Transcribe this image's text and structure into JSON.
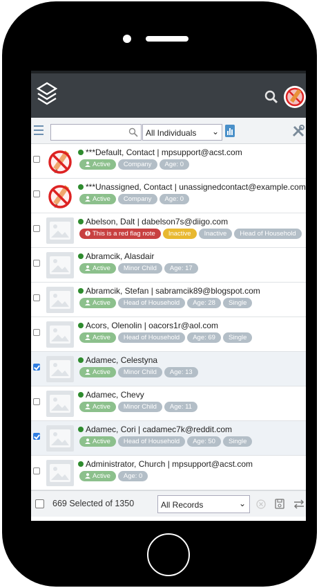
{
  "toolbar": {
    "search_placeholder": "",
    "individuals_select": "All Individuals"
  },
  "records": [
    {
      "name": "***Default, Contact | mpsupport@acst.com",
      "photo": "no-photo",
      "checked": false,
      "badges": [
        {
          "text": "Active",
          "kind": "active"
        },
        {
          "text": "Company",
          "kind": "grey"
        },
        {
          "text": "Age: 0",
          "kind": "grey"
        }
      ]
    },
    {
      "name": "***Unassigned, Contact | unassignedcontact@example.com",
      "photo": "no-photo",
      "checked": false,
      "badges": [
        {
          "text": "Active",
          "kind": "active"
        },
        {
          "text": "Company",
          "kind": "grey"
        },
        {
          "text": "Age: 0",
          "kind": "grey"
        }
      ]
    },
    {
      "name": "Abelson, Dalt | dabelson7s@diigo.com",
      "photo": "placeholder",
      "checked": false,
      "badges": [
        {
          "text": "This is a red flag note",
          "kind": "red"
        },
        {
          "text": "Inactive",
          "kind": "yellow"
        },
        {
          "text": "Inactive",
          "kind": "grey"
        },
        {
          "text": "Head of Household",
          "kind": "grey"
        }
      ]
    },
    {
      "name": "Abramcik, Alasdair",
      "photo": "placeholder",
      "checked": false,
      "badges": [
        {
          "text": "Active",
          "kind": "active"
        },
        {
          "text": "Minor Child",
          "kind": "grey"
        },
        {
          "text": "Age: 17",
          "kind": "grey"
        }
      ]
    },
    {
      "name": "Abramcik, Stefan | sabramcik89@blogspot.com",
      "photo": "placeholder",
      "checked": false,
      "badges": [
        {
          "text": "Active",
          "kind": "active"
        },
        {
          "text": "Head of Household",
          "kind": "grey"
        },
        {
          "text": "Age: 28",
          "kind": "grey"
        },
        {
          "text": "Single",
          "kind": "grey"
        }
      ]
    },
    {
      "name": "Acors, Olenolin | oacors1r@aol.com",
      "photo": "placeholder",
      "checked": false,
      "badges": [
        {
          "text": "Active",
          "kind": "active"
        },
        {
          "text": "Head of Household",
          "kind": "grey"
        },
        {
          "text": "Age: 69",
          "kind": "grey"
        },
        {
          "text": "Single",
          "kind": "grey"
        }
      ]
    },
    {
      "name": "Adamec, Celestyna",
      "photo": "placeholder",
      "checked": true,
      "badges": [
        {
          "text": "Active",
          "kind": "active"
        },
        {
          "text": "Minor Child",
          "kind": "grey"
        },
        {
          "text": "Age: 13",
          "kind": "grey"
        }
      ]
    },
    {
      "name": "Adamec, Chevy",
      "photo": "placeholder",
      "checked": false,
      "badges": [
        {
          "text": "Active",
          "kind": "active"
        },
        {
          "text": "Minor Child",
          "kind": "grey"
        },
        {
          "text": "Age: 11",
          "kind": "grey"
        }
      ]
    },
    {
      "name": "Adamec, Cori | cadamec7k@reddit.com",
      "photo": "placeholder",
      "checked": true,
      "badges": [
        {
          "text": "Active",
          "kind": "active"
        },
        {
          "text": "Head of Household",
          "kind": "grey"
        },
        {
          "text": "Age: 50",
          "kind": "grey"
        },
        {
          "text": "Single",
          "kind": "grey"
        }
      ]
    },
    {
      "name": "Administrator, Church | mpsupport@acst.com",
      "photo": "placeholder",
      "checked": false,
      "badges": [
        {
          "text": "Active",
          "kind": "active"
        },
        {
          "text": "Age: 0",
          "kind": "grey"
        }
      ]
    }
  ],
  "footer": {
    "selection_count": "669 Selected of 1350",
    "records_select": "All Records"
  },
  "colors": {
    "header_bg": "#3a3f44",
    "status_active": "#8cc08c",
    "status_inactive": "#e8b830",
    "red_flag": "#c84040",
    "online_dot": "#2e8b2e",
    "accent": "#4a90c9"
  },
  "icons": [
    "stacked-layers-logo-icon",
    "search-icon",
    "user-avatar-icon",
    "hamburger-menu-icon",
    "bar-chart-icon",
    "tools-icon",
    "clear-circle-icon",
    "save-icon",
    "swap-arrows-icon",
    "person-icon",
    "warning-icon"
  ]
}
